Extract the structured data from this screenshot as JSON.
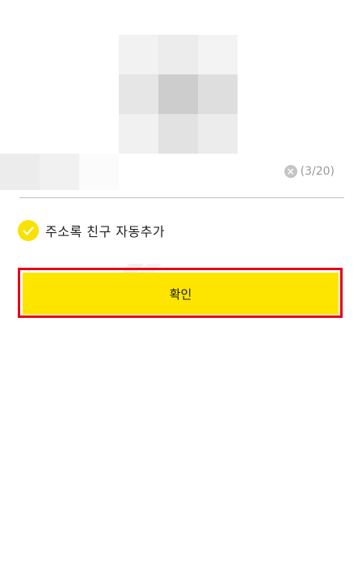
{
  "profile": {
    "image": "pixelated-profile-image",
    "name": "pixelated-name"
  },
  "name_input": {
    "clear_icon": "close-circle-icon",
    "counter": "(3/20)"
  },
  "options": {
    "auto_add_contacts": {
      "label": "주소록 친구 자동추가",
      "checked": true,
      "icon": "check-circle-icon"
    }
  },
  "confirm": {
    "label": "확인"
  },
  "colors": {
    "accent_yellow": "#FEE500",
    "highlight_red": "#E6001A",
    "divider": "#BDBDBD"
  }
}
